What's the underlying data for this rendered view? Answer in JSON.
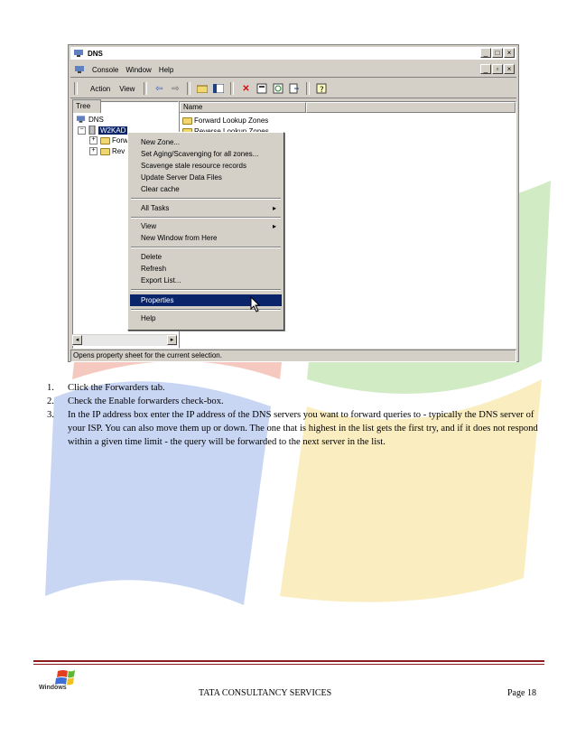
{
  "window": {
    "title": "DNS",
    "menu": [
      "Console",
      "Window",
      "Help"
    ],
    "toolbar": [
      "Action",
      "View"
    ],
    "tree_tab": "Tree",
    "tree": {
      "root": "DNS",
      "server": "W2KAD",
      "children": [
        "Forw",
        "Rev"
      ]
    },
    "list_header": "Name",
    "list_items": [
      "Forward Lookup Zones",
      "Reverse Lookup Zones"
    ],
    "status": "Opens property sheet for the current selection."
  },
  "context_menu": {
    "items": [
      "New Zone...",
      "Set Aging/Scavenging for all zones...",
      "Scavenge stale resource records",
      "Update Server Data Files",
      "Clear cache",
      "All Tasks",
      "View",
      "New Window from Here",
      "Delete",
      "Refresh",
      "Export List...",
      "Properties",
      "Help"
    ],
    "highlighted": "Properties"
  },
  "steps": [
    {
      "num": "1.",
      "text": "Click the Forwarders tab."
    },
    {
      "num": "2.",
      "text": "Check the Enable forwarders check-box."
    },
    {
      "num": "3.",
      "text": "In the IP address box enter the IP address of the DNS servers you want to forward queries to - typically the DNS server of your ISP. You can also move them up or down. The one that is highest in the list gets the first try, and if it does not respond within a given time limit - the query will be forwarded to the next server in the list."
    }
  ],
  "footer": {
    "logo_text": "Windows",
    "company": "TATA CONSULTANCY SERVICES",
    "page": "Page 18"
  },
  "colors": {
    "selection": "#0a246a",
    "rule": "#8b1a1a"
  }
}
